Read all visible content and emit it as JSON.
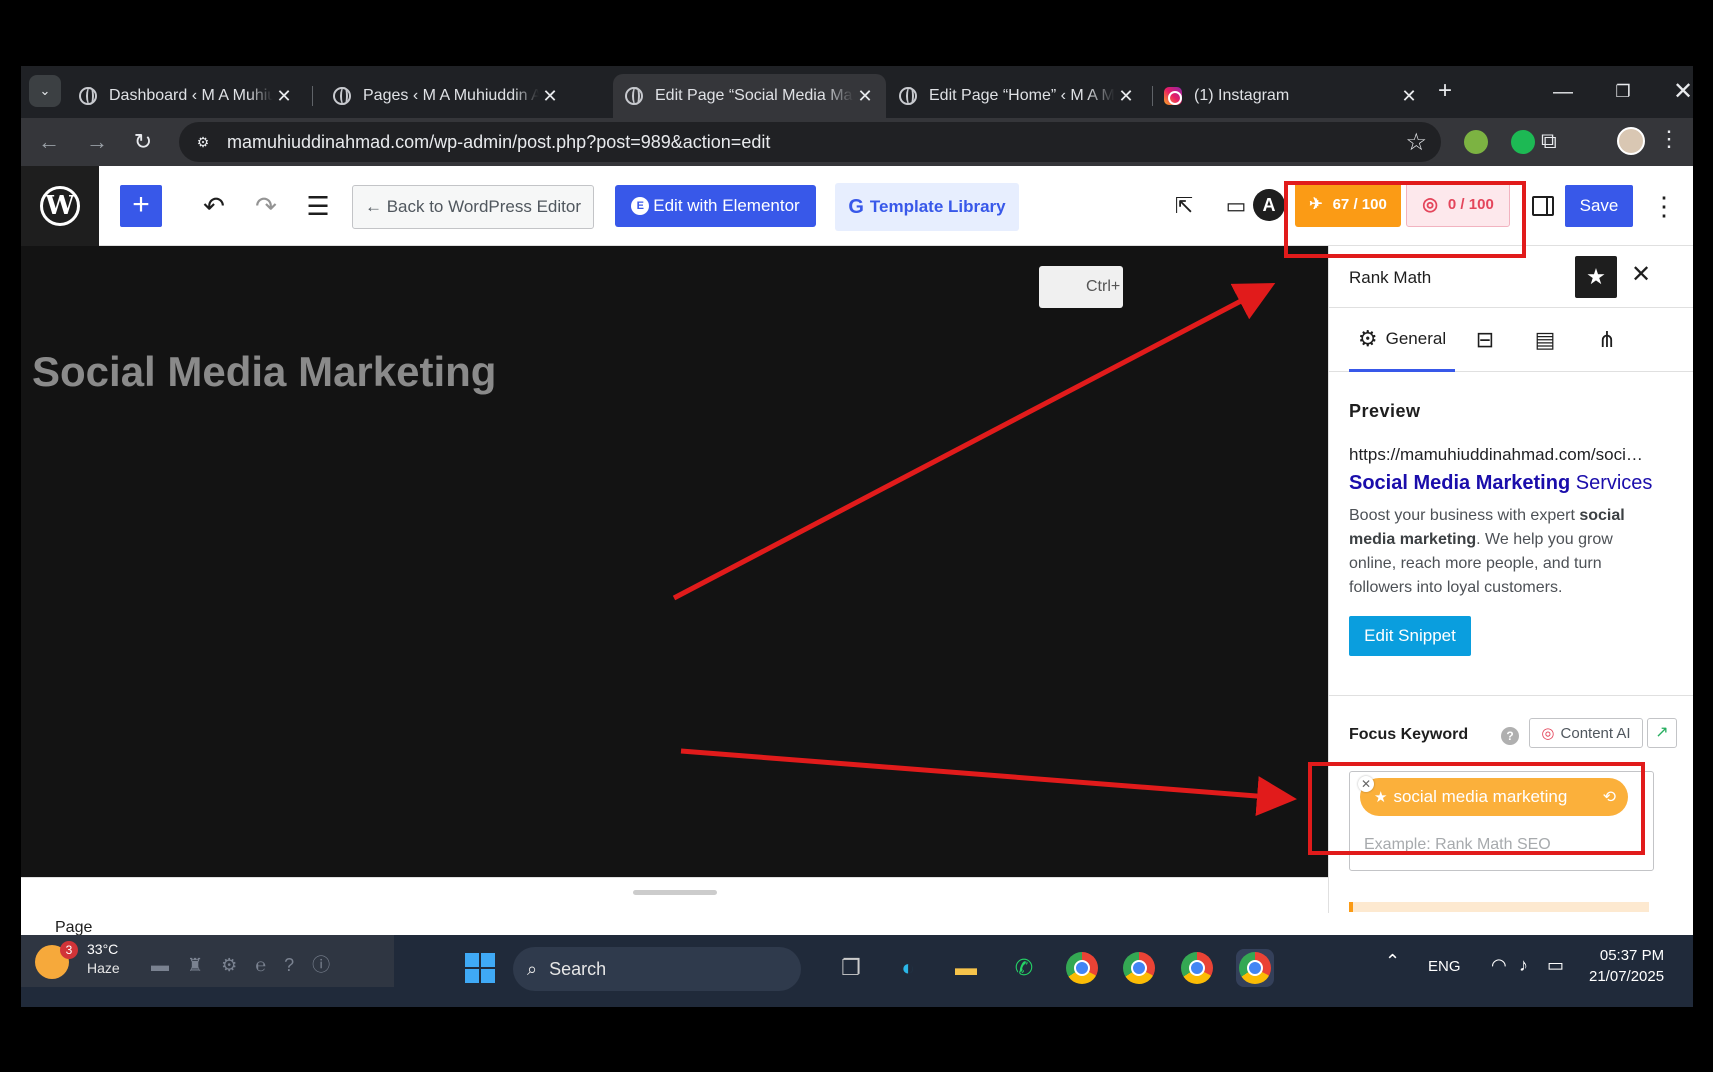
{
  "browser": {
    "tab_list_icon": "chevron-down-icon",
    "tabs": [
      {
        "title": "Dashboard ‹ M A Muhiuddin Ahmad — WordPress",
        "favicon": "globe-icon",
        "active": false
      },
      {
        "title": "Pages ‹ M A Muhiuddin Ahmad — WordPress",
        "favicon": "globe-icon",
        "active": false
      },
      {
        "title": "Edit Page “Social Media Marketing” ‹ M A Muhiuddin",
        "favicon": "globe-icon",
        "active": true
      },
      {
        "title": "Edit Page “Home” ‹ M A Muhiuddin Ahmad",
        "favicon": "globe-icon",
        "active": false
      },
      {
        "title": "(1) Instagram",
        "favicon": "instagram-icon",
        "active": false
      }
    ],
    "url": "mamuhiuddinahmad.com/wp-admin/post.php?post=989&action=edit"
  },
  "wp_toolbar": {
    "back_label": "← Back to WordPress Editor",
    "elementor_label": "Edit with Elementor",
    "template_label": "Template Library",
    "seo_score": "67 / 100",
    "ai_score": "0 / 100",
    "save_label": "Save"
  },
  "canvas": {
    "page_title": "Social Media Marketing",
    "shortcut_hint": "Ctrl+"
  },
  "sidebar": {
    "title": "Rank Math",
    "tabs": [
      {
        "label": "General",
        "icon": "gear-icon"
      },
      {
        "label": "",
        "icon": "toolbox-icon"
      },
      {
        "label": "",
        "icon": "schema-icon"
      },
      {
        "label": "",
        "icon": "social-share-icon"
      }
    ],
    "preview_heading": "Preview",
    "snippet": {
      "url": "https://mamuhiuddinahmad.com/social-media-marketing/",
      "title_bold": "Social Media Marketing",
      "title_rest": " Services",
      "desc_1": "Boost your business with expert ",
      "desc_bold_1": "social media marketing",
      "desc_2": ". We help you grow online, reach more people, and turn followers into loyal customers."
    },
    "edit_snippet_label": "Edit Snippet",
    "focus_keyword_label": "Focus Keyword",
    "content_ai_label": "Content AI",
    "keyword": "social media marketing",
    "keyword_placeholder": "Example: Rank Math SEO"
  },
  "footer": {
    "breadcrumb": "Page"
  },
  "taskbar": {
    "weather_badge": "3",
    "temperature": "33°C",
    "condition": "Haze",
    "search_label": "Search",
    "language": "ENG",
    "time": "05:37 PM",
    "date": "21/07/2025"
  },
  "colors": {
    "annotation_red": "#e11b1b",
    "wp_blue": "#3858e9",
    "rank_math_orange": "#fb9b15",
    "content_ai_pink": "#e4455b"
  }
}
